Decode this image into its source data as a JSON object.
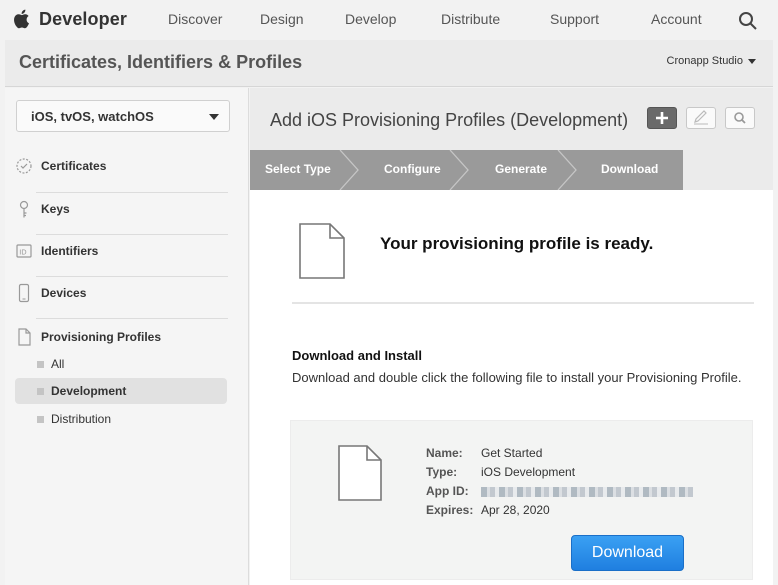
{
  "topnav": {
    "brand": "Developer",
    "items": [
      "Discover",
      "Design",
      "Develop",
      "Distribute",
      "Support",
      "Account"
    ]
  },
  "header": {
    "title": "Certificates, Identifiers & Profiles",
    "team": "Cronapp Studio"
  },
  "sidebar": {
    "platform": "iOS, tvOS, watchOS",
    "sections": [
      {
        "label": "Certificates",
        "icon": "certificate-icon"
      },
      {
        "label": "Keys",
        "icon": "key-icon"
      },
      {
        "label": "Identifiers",
        "icon": "id-icon"
      },
      {
        "label": "Devices",
        "icon": "device-icon"
      },
      {
        "label": "Provisioning Profiles",
        "icon": "document-icon"
      }
    ],
    "profiles": [
      "All",
      "Development",
      "Distribution"
    ],
    "active_profile": "Development"
  },
  "main": {
    "title": "Add iOS Provisioning Profiles (Development)",
    "toolbar": [
      "add-icon",
      "edit-icon",
      "search-icon"
    ],
    "steps": [
      "Select Type",
      "Configure",
      "Generate",
      "Download"
    ],
    "ready": "Your provisioning profile is ready.",
    "download_heading": "Download and Install",
    "download_desc": "Download and double click the following file to install your Provisioning Profile.",
    "profile": {
      "name_label": "Name:",
      "name": "Get Started",
      "type_label": "Type:",
      "type": "iOS Development",
      "appid_label": "App ID:",
      "expires_label": "Expires:",
      "expires": "Apr 28, 2020"
    },
    "download_button": "Download"
  },
  "colors": {
    "accent": "#1f7fe0",
    "steps_bar": "#9a9a9a",
    "active_bg": "#e1e1e1"
  }
}
